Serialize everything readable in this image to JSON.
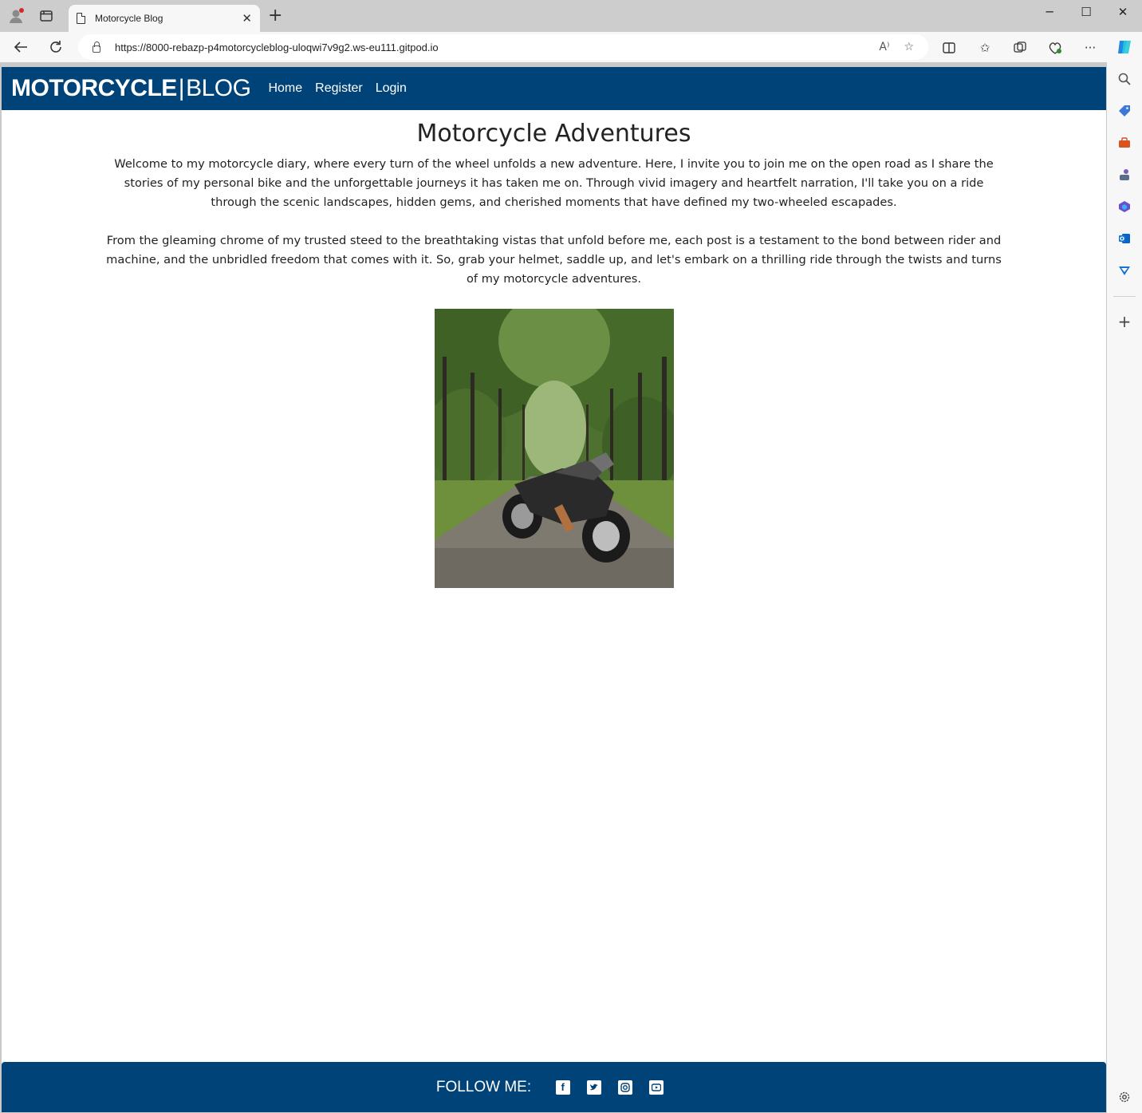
{
  "browser": {
    "tab_title": "Motorcycle Blog",
    "url": "https://8000-rebazp-p4motorcycleblog-uloqwi7v9g2.ws-eu111.gitpod.io",
    "read_aloud_label": "A⁾"
  },
  "navbar": {
    "brand_bold": "MOTORCYCLE",
    "brand_sep": "|",
    "brand_light": "BLOG",
    "links": [
      "Home",
      "Register",
      "Login"
    ]
  },
  "main": {
    "heading": "Motorcycle Adventures",
    "paragraphs": [
      "Welcome to my motorcycle diary, where every turn of the wheel unfolds a new adventure. Here, I invite you to join me on the open road as I share the stories of my personal bike and the unforgettable journeys it has taken me on. Through vivid imagery and heartfelt narration, I'll take you on a ride through the scenic landscapes, hidden gems, and cherished moments that have defined my two-wheeled escapades.",
      "From the gleaming chrome of my trusted steed to the breathtaking vistas that unfold before me, each post is a testament to the bond between rider and machine, and the unbridled freedom that comes with it. So, grab your helmet, saddle up, and let's embark on a thrilling ride through the twists and turns of my motorcycle adventures."
    ]
  },
  "footer": {
    "follow_label": "FOLLOW ME:",
    "social_icons": [
      "facebook-icon",
      "twitter-icon",
      "instagram-icon",
      "youtube-icon"
    ]
  },
  "colors": {
    "brand_navy": "#004378",
    "page_bg": "#ffffff",
    "chrome_bg": "#f7f7f7"
  }
}
